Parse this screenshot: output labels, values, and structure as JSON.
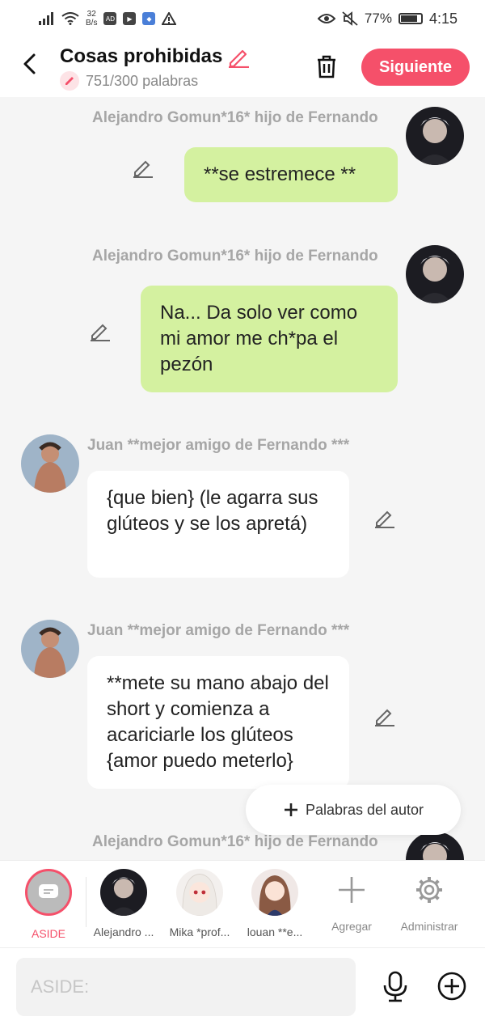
{
  "status": {
    "speed_value": "32",
    "speed_unit": "B/s",
    "battery": "77%",
    "time": "4:15"
  },
  "header": {
    "title": "Cosas prohibidas",
    "word_count": "751/300 palabras",
    "next_label": "Siguiente"
  },
  "messages": [
    {
      "name": "Alejandro Gomun*16* hijo de Fernando",
      "text": "**se estremece **",
      "side": "right"
    },
    {
      "name": "Alejandro Gomun*16* hijo de Fernando",
      "text": "Na... Da solo ver como mi amor me ch*pa el pezón",
      "side": "right"
    },
    {
      "name": "Juan **mejor amigo de Fernando ***",
      "text": "{que bien} (le agarra sus glúteos y se los apretá)",
      "side": "left"
    },
    {
      "name": "Juan **mejor amigo de Fernando ***",
      "text": "**mete su mano abajo del short y comienza a acariciarle los glúteos {amor puedo meterlo}",
      "side": "left"
    },
    {
      "name": "Alejandro Gomun*16* hijo de Fernando",
      "text": "",
      "side": "right"
    }
  ],
  "floating": {
    "label": "Palabras del autor"
  },
  "characters": [
    {
      "label": "ASIDE"
    },
    {
      "label": "Alejandro ..."
    },
    {
      "label": "Mika *prof..."
    },
    {
      "label": "louan **e..."
    },
    {
      "label": "Agregar"
    },
    {
      "label": "Administrar"
    }
  ],
  "input": {
    "placeholder": "ASIDE:"
  },
  "colors": {
    "accent": "#f5506a",
    "green_bubble": "#d4f1a0",
    "name_gray": "#a6a6a6"
  },
  "icons": [
    "back-arrow-icon",
    "pencil-icon",
    "trash-icon",
    "edit-icon",
    "plus-icon",
    "gear-icon",
    "microphone-icon",
    "add-circle-icon"
  ]
}
